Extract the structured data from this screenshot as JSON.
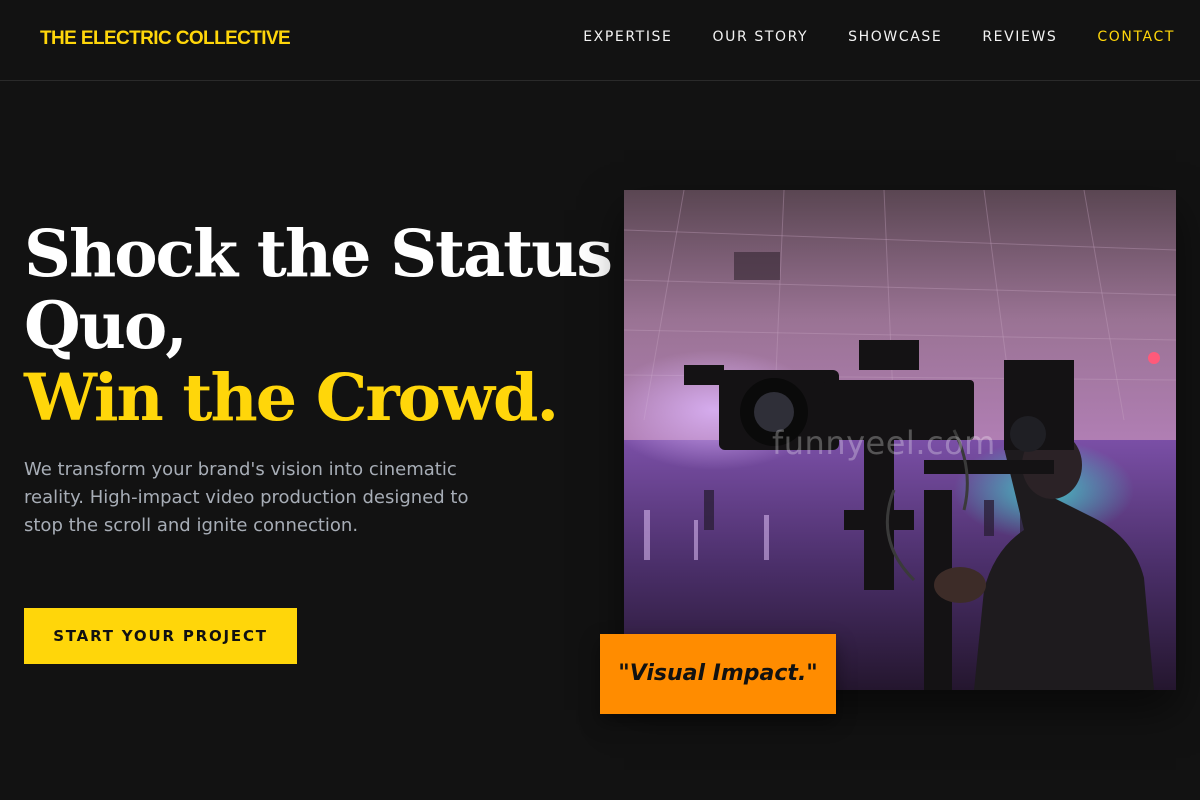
{
  "nav": {
    "brand": "THE ELECTRIC COLLECTIVE",
    "links": [
      {
        "label": "EXPERTISE"
      },
      {
        "label": "OUR STORY"
      },
      {
        "label": "SHOWCASE"
      },
      {
        "label": "REVIEWS"
      },
      {
        "label": "CONTACT"
      }
    ]
  },
  "hero": {
    "headline_line1": "Shock the Status",
    "headline_line2": "Quo,",
    "headline_highlight": "Win the Crowd.",
    "description": "We transform your brand's vision into cinematic reality. High-impact video production designed to stop the scroll and ignite connection.",
    "cta_label": "START YOUR PROJECT"
  },
  "media": {
    "watermark": "funnyeel.com",
    "badge": "\"Visual Impact.\""
  },
  "colors": {
    "background": "#121212",
    "accent_yellow": "#ffd60a",
    "accent_orange": "#ff8c00",
    "text_muted": "#a7adb6"
  }
}
